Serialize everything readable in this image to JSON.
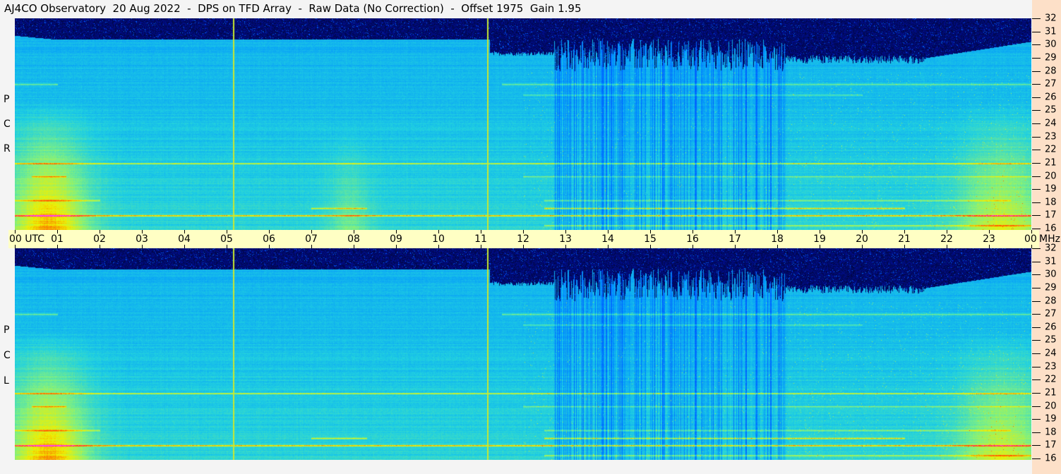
{
  "title": "AJ4CO Observatory  20 Aug 2022  -  DPS on TFD Array  -  Raw Data (No Correction)  -  Offset 1975  Gain 1.95",
  "chart_data": {
    "type": "heatmap",
    "title": "AJ4CO Observatory  20 Aug 2022  -  DPS on TFD Array  -  Raw Data (No Correction)  -  Offset 1975  Gain 1.95",
    "panels": [
      {
        "name": "RCP",
        "label_letters": [
          "R",
          "C",
          "P"
        ]
      },
      {
        "name": "LCP",
        "label_letters": [
          "L",
          "C",
          "P"
        ]
      }
    ],
    "x_axis": {
      "label": "UTC",
      "range_hours": [
        0,
        24
      ],
      "ticks": [
        "00",
        "01",
        "02",
        "03",
        "04",
        "05",
        "06",
        "07",
        "08",
        "09",
        "10",
        "11",
        "12",
        "13",
        "14",
        "15",
        "16",
        "17",
        "18",
        "19",
        "20",
        "21",
        "22",
        "23",
        "00"
      ],
      "first_tick_suffix": "UTC"
    },
    "y_axis": {
      "label": "MHz",
      "range": [
        16,
        32
      ],
      "ticks": [
        16,
        17,
        18,
        19,
        20,
        21,
        22,
        23,
        24,
        25,
        26,
        27,
        28,
        29,
        30,
        31,
        32
      ]
    },
    "markers_hours": [
      5.15,
      11.15
    ],
    "marker_color": "#c8e830",
    "interference_bands_mhz": [
      16.3,
      17.05,
      17.6,
      18.2,
      20.0,
      21.0,
      27.0
    ],
    "colormap": [
      "#000010",
      "#0010a0",
      "#0050ff",
      "#0090ff",
      "#20d0e0",
      "#80f080",
      "#f0f000",
      "#ff4000",
      "#ff40ff"
    ]
  }
}
